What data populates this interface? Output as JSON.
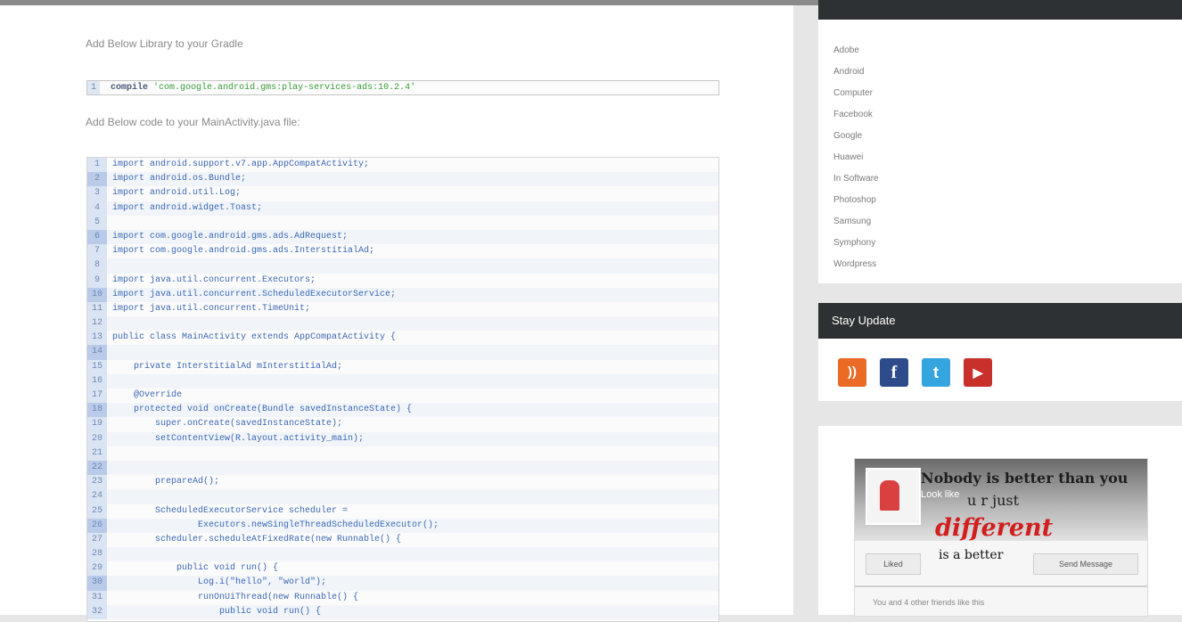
{
  "main": {
    "intro_gradle": "Add Below Library to your Gradle",
    "gradle_line_number": "1",
    "gradle_keyword": "compile",
    "gradle_value": "'com.google.android.gms:play-services-ads:10.2.4'",
    "intro_activity": "Add Below code to your MainActivity.java file:"
  },
  "code": {
    "lines": [
      {
        "n": "1",
        "text": "import android.support.v7.app.AppCompatActivity;"
      },
      {
        "n": "2",
        "text": "import android.os.Bundle;"
      },
      {
        "n": "3",
        "text": "import android.util.Log;"
      },
      {
        "n": "4",
        "text": "import android.widget.Toast;"
      },
      {
        "n": "5",
        "text": ""
      },
      {
        "n": "6",
        "text": "import com.google.android.gms.ads.AdRequest;"
      },
      {
        "n": "7",
        "text": "import com.google.android.gms.ads.InterstitialAd;"
      },
      {
        "n": "8",
        "text": ""
      },
      {
        "n": "9",
        "text": "import java.util.concurrent.Executors;"
      },
      {
        "n": "10",
        "text": "import java.util.concurrent.ScheduledExecutorService;"
      },
      {
        "n": "11",
        "text": "import java.util.concurrent.TimeUnit;"
      },
      {
        "n": "12",
        "text": ""
      },
      {
        "n": "13",
        "text": "public class MainActivity extends AppCompatActivity {"
      },
      {
        "n": "14",
        "text": ""
      },
      {
        "n": "15",
        "text": "    private InterstitialAd mInterstitialAd;"
      },
      {
        "n": "16",
        "text": ""
      },
      {
        "n": "17",
        "text": "    @Override"
      },
      {
        "n": "18",
        "text": "    protected void onCreate(Bundle savedInstanceState) {"
      },
      {
        "n": "19",
        "text": "        super.onCreate(savedInstanceState);"
      },
      {
        "n": "20",
        "text": "        setContentView(R.layout.activity_main);"
      },
      {
        "n": "21",
        "text": ""
      },
      {
        "n": "22",
        "text": ""
      },
      {
        "n": "23",
        "text": "        prepareAd();"
      },
      {
        "n": "24",
        "text": ""
      },
      {
        "n": "25",
        "text": "        ScheduledExecutorService scheduler ="
      },
      {
        "n": "26",
        "text": "                Executors.newSingleThreadScheduledExecutor();"
      },
      {
        "n": "27",
        "text": "        scheduler.scheduleAtFixedRate(new Runnable() {"
      },
      {
        "n": "28",
        "text": ""
      },
      {
        "n": "29",
        "text": "            public void run() {"
      },
      {
        "n": "30",
        "text": "                Log.i(\"hello\", \"world\");"
      },
      {
        "n": "31",
        "text": "                runOnUiThread(new Runnable() {"
      },
      {
        "n": "32",
        "text": "                    public void run() {"
      }
    ]
  },
  "categories": {
    "items": [
      "Adobe",
      "Android",
      "Computer",
      "Facebook",
      "Google",
      "Huawei",
      "In Software",
      "Photoshop",
      "Samsung",
      "Symphony",
      "Wordpress"
    ]
  },
  "stay_updated": {
    "title": "Stay Update",
    "icons": [
      "rss-icon",
      "facebook-icon",
      "twitter-icon",
      "youtube-icon"
    ],
    "rss_glyph": "))",
    "facebook_glyph": "f",
    "twitter_glyph": "t",
    "youtube_glyph": "▶"
  },
  "fb_widget": {
    "page_name": "Nobody is better than you",
    "small_text": "Look like",
    "line2": "u r just",
    "different": "different",
    "like_label": "Liked",
    "better": "is a better",
    "message_label": "Send Message",
    "friends": "You and 4 other friends like this"
  },
  "colors": {
    "sidebar_header": "#2e3133",
    "page_bg": "#e6e6e6",
    "code_keyword": "#8a2d8a",
    "code_default": "#3a68b5",
    "string_green": "#3aa03a"
  }
}
